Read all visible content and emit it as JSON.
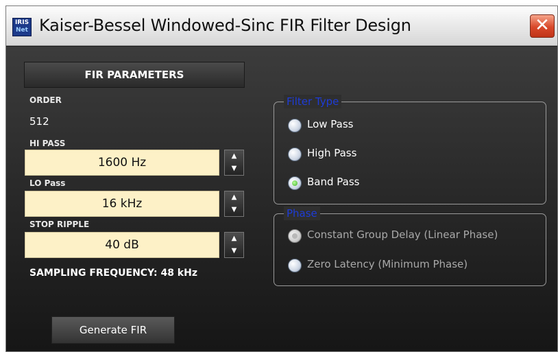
{
  "window": {
    "title": "Kaiser-Bessel Windowed-Sinc FIR Filter Design",
    "icon_top": "IRIS",
    "icon_bottom": "Net",
    "close_symbol": "✕"
  },
  "fir": {
    "header": "FIR PARAMETERS",
    "order_label": "ORDER",
    "order_value": "512",
    "hipass_label": "HI PASS",
    "hipass_value": "1600 Hz",
    "lopass_label": "LO Pass",
    "lopass_value": "16 kHz",
    "ripple_label": "STOP RIPPLE",
    "ripple_value": "40 dB",
    "sampling_text": "SAMPLING FREQUENCY: 48 kHz",
    "generate_label": "Generate FIR",
    "spin_up_symbol": "▲",
    "spin_down_symbol": "▼"
  },
  "filter_type": {
    "legend": "Filter Type",
    "options": [
      {
        "label": "Low Pass",
        "selected": false
      },
      {
        "label": "High Pass",
        "selected": false
      },
      {
        "label": "Band Pass",
        "selected": true
      }
    ]
  },
  "phase": {
    "legend": "Phase",
    "disabled": true,
    "options": [
      {
        "label": "Constant Group Delay (Linear Phase)",
        "selected": true
      },
      {
        "label": "Zero Latency (Minimum Phase)",
        "selected": false
      }
    ]
  },
  "colors": {
    "input_bg": "#fdf1c7",
    "legend_text": "#1e3cd8",
    "close_red": "#d8482a",
    "selected_radio": "#3fae2a"
  }
}
